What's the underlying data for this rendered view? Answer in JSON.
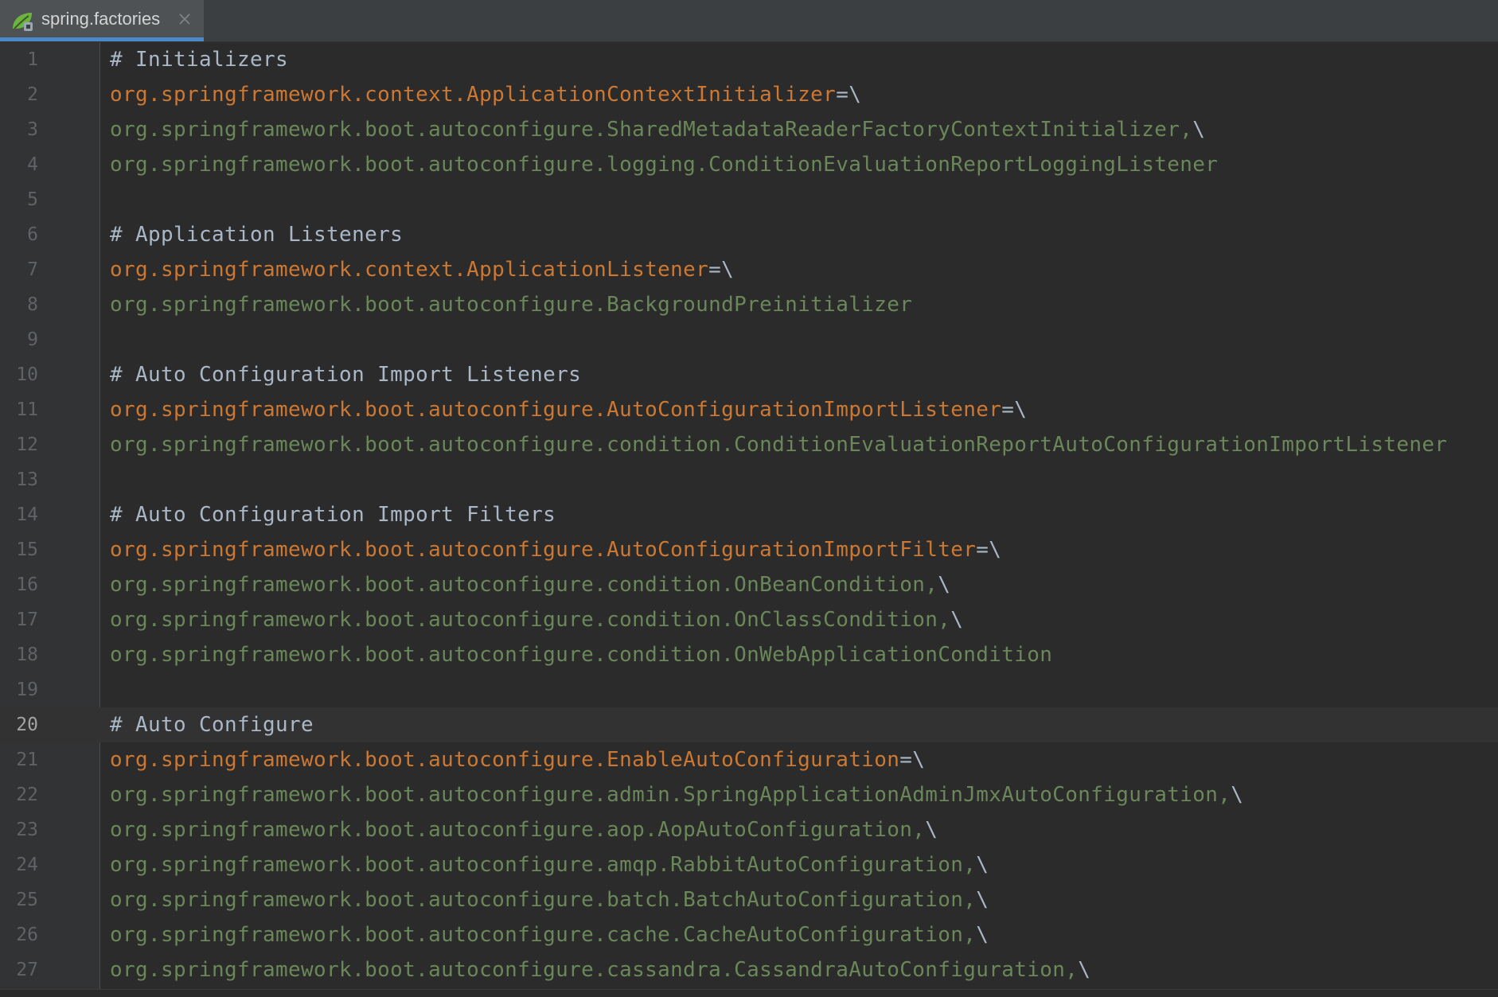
{
  "tab": {
    "label": "spring.factories",
    "icon": "spring-leaf-icon",
    "close_icon": "close-icon",
    "accent_color": "#4a88c7"
  },
  "editor": {
    "current_line": 20,
    "lines": [
      {
        "num": "1",
        "segments": [
          {
            "t": "cmt",
            "text": "# Initializers"
          }
        ]
      },
      {
        "num": "2",
        "segments": [
          {
            "t": "key",
            "text": "org.springframework.context.ApplicationContextInitializer"
          },
          {
            "t": "sep",
            "text": "=\\"
          }
        ]
      },
      {
        "num": "3",
        "segments": [
          {
            "t": "val",
            "text": "org.springframework.boot.autoconfigure.SharedMetadataReaderFactoryContextInitializer,"
          },
          {
            "t": "sep",
            "text": "\\"
          }
        ]
      },
      {
        "num": "4",
        "segments": [
          {
            "t": "val",
            "text": "org.springframework.boot.autoconfigure.logging.ConditionEvaluationReportLoggingListener"
          }
        ]
      },
      {
        "num": "5",
        "segments": []
      },
      {
        "num": "6",
        "segments": [
          {
            "t": "cmt",
            "text": "# Application Listeners"
          }
        ]
      },
      {
        "num": "7",
        "segments": [
          {
            "t": "key",
            "text": "org.springframework.context.ApplicationListener"
          },
          {
            "t": "sep",
            "text": "=\\"
          }
        ]
      },
      {
        "num": "8",
        "segments": [
          {
            "t": "val",
            "text": "org.springframework.boot.autoconfigure.BackgroundPreinitializer"
          }
        ]
      },
      {
        "num": "9",
        "segments": []
      },
      {
        "num": "10",
        "segments": [
          {
            "t": "cmt",
            "text": "# Auto Configuration Import Listeners"
          }
        ]
      },
      {
        "num": "11",
        "segments": [
          {
            "t": "key",
            "text": "org.springframework.boot.autoconfigure.AutoConfigurationImportListener"
          },
          {
            "t": "sep",
            "text": "=\\"
          }
        ]
      },
      {
        "num": "12",
        "segments": [
          {
            "t": "val",
            "text": "org.springframework.boot.autoconfigure.condition.ConditionEvaluationReportAutoConfigurationImportListener"
          }
        ]
      },
      {
        "num": "13",
        "segments": []
      },
      {
        "num": "14",
        "segments": [
          {
            "t": "cmt",
            "text": "# Auto Configuration Import Filters"
          }
        ]
      },
      {
        "num": "15",
        "segments": [
          {
            "t": "key",
            "text": "org.springframework.boot.autoconfigure.AutoConfigurationImportFilter"
          },
          {
            "t": "sep",
            "text": "=\\"
          }
        ]
      },
      {
        "num": "16",
        "segments": [
          {
            "t": "val",
            "text": "org.springframework.boot.autoconfigure.condition.OnBeanCondition,"
          },
          {
            "t": "sep",
            "text": "\\"
          }
        ]
      },
      {
        "num": "17",
        "segments": [
          {
            "t": "val",
            "text": "org.springframework.boot.autoconfigure.condition.OnClassCondition,"
          },
          {
            "t": "sep",
            "text": "\\"
          }
        ]
      },
      {
        "num": "18",
        "segments": [
          {
            "t": "val",
            "text": "org.springframework.boot.autoconfigure.condition.OnWebApplicationCondition"
          }
        ]
      },
      {
        "num": "19",
        "segments": []
      },
      {
        "num": "20",
        "segments": [
          {
            "t": "cmt",
            "text": "# Auto Configure"
          }
        ]
      },
      {
        "num": "21",
        "segments": [
          {
            "t": "key",
            "text": "org.springframework.boot.autoconfigure.EnableAutoConfiguration"
          },
          {
            "t": "sep",
            "text": "=\\"
          }
        ]
      },
      {
        "num": "22",
        "segments": [
          {
            "t": "val",
            "text": "org.springframework.boot.autoconfigure.admin.SpringApplicationAdminJmxAutoConfiguration,"
          },
          {
            "t": "sep",
            "text": "\\"
          }
        ]
      },
      {
        "num": "23",
        "segments": [
          {
            "t": "val",
            "text": "org.springframework.boot.autoconfigure.aop.AopAutoConfiguration,"
          },
          {
            "t": "sep",
            "text": "\\"
          }
        ]
      },
      {
        "num": "24",
        "segments": [
          {
            "t": "val",
            "text": "org.springframework.boot.autoconfigure.amqp.RabbitAutoConfiguration,"
          },
          {
            "t": "sep",
            "text": "\\"
          }
        ]
      },
      {
        "num": "25",
        "segments": [
          {
            "t": "val",
            "text": "org.springframework.boot.autoconfigure.batch.BatchAutoConfiguration,"
          },
          {
            "t": "sep",
            "text": "\\"
          }
        ]
      },
      {
        "num": "26",
        "segments": [
          {
            "t": "val",
            "text": "org.springframework.boot.autoconfigure.cache.CacheAutoConfiguration,"
          },
          {
            "t": "sep",
            "text": "\\"
          }
        ]
      },
      {
        "num": "27",
        "segments": [
          {
            "t": "val",
            "text": "org.springframework.boot.autoconfigure.cassandra.CassandraAutoConfiguration,"
          },
          {
            "t": "sep",
            "text": "\\"
          }
        ]
      }
    ]
  },
  "colors": {
    "key": "#cc7832",
    "value": "#6a8759",
    "comment": "#a9b7c6",
    "background": "#2b2b2b"
  }
}
